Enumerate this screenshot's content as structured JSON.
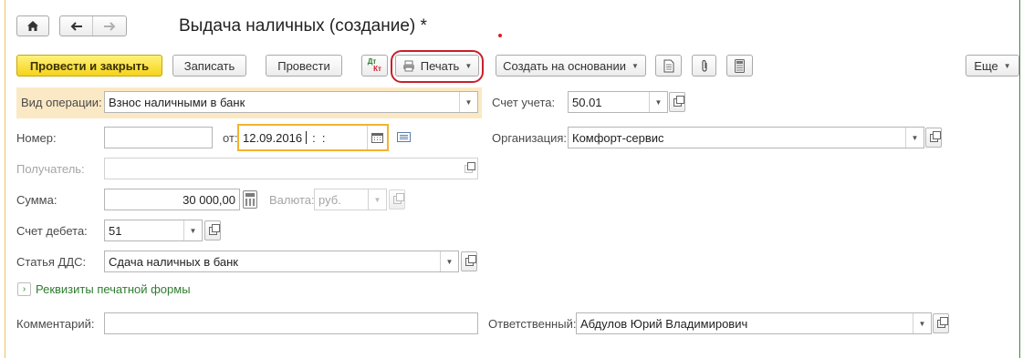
{
  "nav": {
    "home_icon": "home-icon",
    "back_icon": "arrow-left-icon",
    "forward_icon": "arrow-right-icon"
  },
  "title": "Выдача наличных (создание) *",
  "toolbar": {
    "post_close": "Провести и закрыть",
    "save": "Записать",
    "post": "Провести",
    "dt_kt_top": "Дт",
    "dt_kt_bottom": "Кт",
    "print": "Печать",
    "create_based": "Создать на основании",
    "more": "Еще",
    "icons": [
      "printer-icon",
      "document-icon",
      "paperclip-icon",
      "calculator-icon"
    ]
  },
  "form": {
    "operation_type": {
      "label": "Вид операции:",
      "value": "Взнос наличными в банк"
    },
    "account": {
      "label": "Счет учета:",
      "value": "50.01"
    },
    "number": {
      "label": "Номер:",
      "value": ""
    },
    "date": {
      "label": "от:",
      "value": "12.09.2016",
      "time": ":  :"
    },
    "organization": {
      "label": "Организация:",
      "value": "Комфорт-сервис"
    },
    "recipient": {
      "label": "Получатель:",
      "value": ""
    },
    "amount": {
      "label": "Сумма:",
      "value": "30 000,00"
    },
    "currency": {
      "label": "Валюта:",
      "value": "руб."
    },
    "debit_account": {
      "label": "Счет дебета:",
      "value": "51"
    },
    "cash_flow_item": {
      "label": "Статья ДДС:",
      "value": "Сдача наличных в банк"
    },
    "print_details": {
      "expander": "›",
      "label": "Реквизиты печатной формы"
    },
    "comment": {
      "label": "Комментарий:",
      "value": ""
    },
    "responsible": {
      "label": "Ответственный:",
      "value": "Абдулов Юрий Владимирович"
    }
  },
  "colors": {
    "primary_button": "#f5d31b",
    "operation_band": "#fbe9c5",
    "focus_border": "#f2b32d",
    "link_green": "#2f7d2f",
    "highlight_red": "#c8202a"
  }
}
